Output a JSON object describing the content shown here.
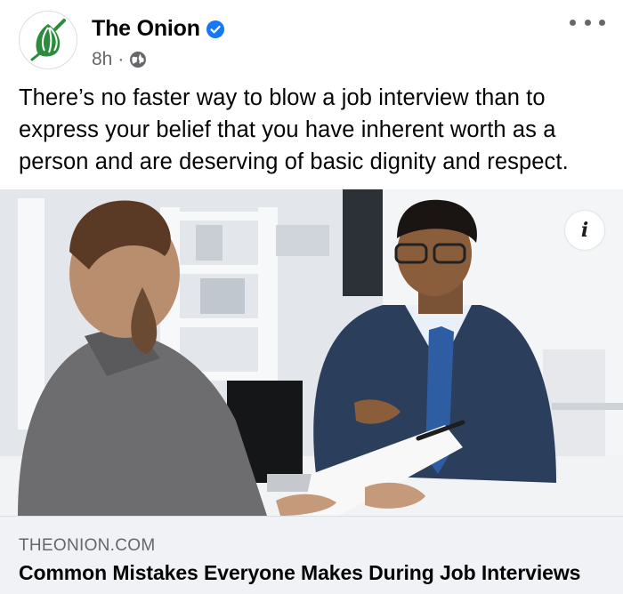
{
  "post": {
    "page_name": "The Onion",
    "timestamp": "8h",
    "separator": "·",
    "audience_icon": "globe-icon",
    "caption": "There’s no faster way to blow a job interview than to express your belief that you have inherent worth as a person and are deserving of basic dignity and respect."
  },
  "link": {
    "domain": "THEONION.COM",
    "title": "Common Mistakes Everyone Makes During Job Interviews",
    "info_label": "i"
  },
  "colors": {
    "brand_green": "#2e8b3e",
    "verified_blue": "#1877f2",
    "muted_text": "#65676b",
    "link_card_bg": "#f0f2f5"
  }
}
